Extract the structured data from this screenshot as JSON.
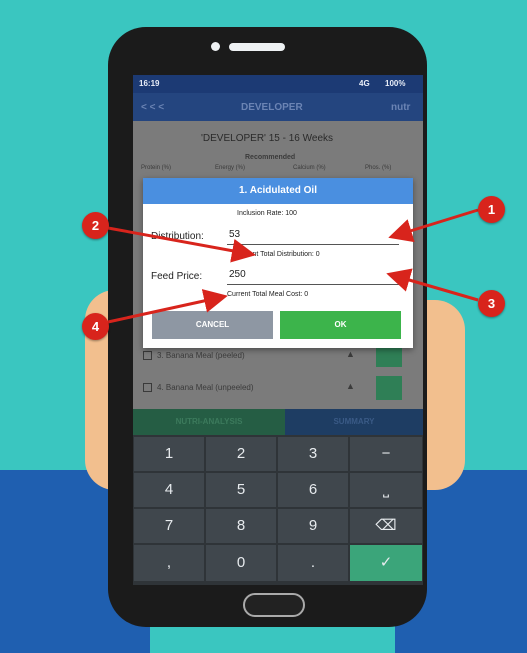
{
  "status_bar": {
    "time": "16:19",
    "network": "4G",
    "battery": "100%"
  },
  "app_bar": {
    "title": "DEVELOPER",
    "left_nav": "< < <",
    "right_action": "nutr"
  },
  "page": {
    "heading": "'DEVELOPER' 15 - 16 Weeks",
    "recommended_label": "Recommended",
    "columns": [
      "Protein (%)",
      "Energy (%)",
      "Calcium (%)",
      "Phos. (%)"
    ]
  },
  "ingredients": [
    {
      "label": "3. Banana Meal (peeled)"
    },
    {
      "label": "4. Banana Meal (unpeeled)"
    }
  ],
  "dialog": {
    "title": "1. Acidulated Oil",
    "inclusion_rate": "Inclusion Rate: 100",
    "distribution_label": "Distribution:",
    "distribution_value": "53",
    "current_total_distribution": "Current Total Distribution: 0",
    "feed_price_label": "Feed Price:",
    "feed_price_value": "250",
    "current_total_meal_cost": "Current Total Meal Cost: 0",
    "cancel_label": "CANCEL",
    "ok_label": "OK"
  },
  "tabs": {
    "left": "NUTRI-ANALYSIS",
    "right": "SUMMARY"
  },
  "keypad": {
    "row1": [
      "1",
      "2",
      "3",
      "−"
    ],
    "row2": [
      "4",
      "5",
      "6",
      "⎵"
    ],
    "row3": [
      "7",
      "8",
      "9",
      "⌫"
    ],
    "row4": [
      ",",
      "0",
      ".",
      "✓"
    ]
  },
  "callouts": [
    "1",
    "2",
    "3",
    "4"
  ],
  "colors": {
    "background": "#3ac6c0",
    "dialog_title": "#4a8fe0",
    "ok_button": "#3cb44b",
    "cancel_button": "#8e97a3",
    "callout": "#d8241c"
  }
}
